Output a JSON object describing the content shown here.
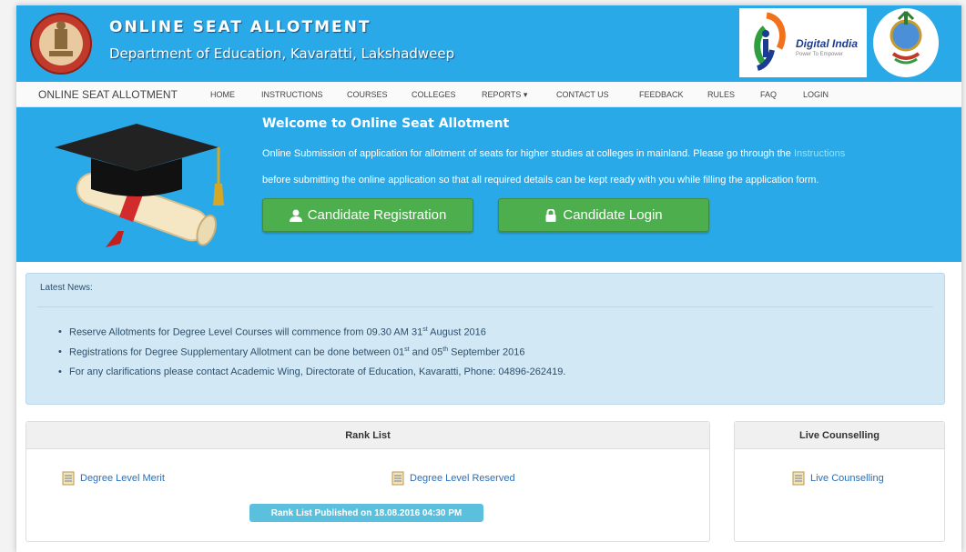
{
  "header": {
    "title": "ONLINE SEAT ALLOTMENT",
    "subtitle": "Department of Education, Kavaratti, Lakshadweep",
    "digital_india": "Digital India",
    "digital_india_tag": "Power To Empower"
  },
  "nav": {
    "brand": "ONLINE SEAT ALLOTMENT",
    "items": [
      "HOME",
      "INSTRUCTIONS",
      "COURSES",
      "COLLEGES",
      "REPORTS ▾",
      "CONTACT US",
      "FEEDBACK",
      "RULES",
      "FAQ",
      "LOGIN"
    ]
  },
  "hero": {
    "title": "Welcome to Online Seat Allotment",
    "line1": "Online Submission of application for allotment of seats for higher studies at colleges in mainland. Please go through the ",
    "line1_link": "Instructions",
    "line2": "before submitting the online application so that all required details can be kept ready with you while filling the application form.",
    "register_label": "Candidate Registration",
    "login_label": "Candidate Login"
  },
  "news": {
    "title": "Latest News:",
    "items": [
      {
        "pre": "Reserve Allotments for Degree Level Courses will commence from 09.30 AM 31",
        "sup": "st",
        "post": " August 2016"
      },
      {
        "pre": "Registrations for Degree Supplementary Allotment can be done between 01",
        "sup": "st",
        "mid": " and 05",
        "sup2": "th",
        "post": " September 2016"
      },
      {
        "pre": "For any clarifications please contact Academic Wing, Directorate of Education, Kavaratti, Phone: 04896-262419."
      }
    ]
  },
  "rank_list": {
    "title": "Rank List",
    "merit_link": "Degree Level Merit",
    "reserved_link": "Degree Level Reserved",
    "published": "Rank List Published on 18.08.2016 04:30 PM"
  },
  "live_counselling": {
    "title": "Live Counselling",
    "link": "Live Counselling"
  },
  "colors": {
    "header_blue": "#2aa9e8",
    "button_green": "#4cae4c",
    "news_bg": "#d2e8f4",
    "badge_info": "#5bc0de"
  },
  "icons": [
    "state-emblem-icon",
    "digital-india-logo",
    "lakshadweep-logo",
    "graduation-cap-icon",
    "user-icon",
    "lock-icon",
    "document-icon"
  ]
}
